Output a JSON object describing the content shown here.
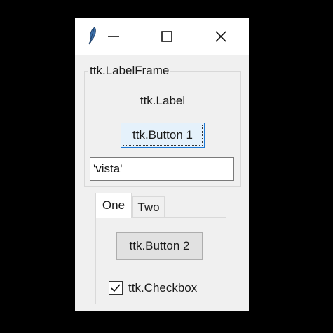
{
  "titlebar": {
    "app_icon": "feather-icon",
    "minimize_icon": "minimize-icon",
    "maximize_icon": "maximize-icon",
    "close_icon": "close-icon"
  },
  "labelframe": {
    "title": "ttk.LabelFrame",
    "label": "ttk.Label",
    "button_label": "ttk.Button 1",
    "entry_value": "'vista'"
  },
  "notebook": {
    "tabs": [
      {
        "label": "One",
        "selected": true
      },
      {
        "label": "Two",
        "selected": false
      }
    ],
    "button_label": "ttk.Button 2",
    "checkbox_label": "ttk.Checkbox",
    "checkbox_checked": true
  },
  "colors": {
    "window_bg": "#f0f0f0",
    "titlebar_bg": "#ffffff",
    "focus_border": "#1e78d4",
    "backdrop": "#000000"
  }
}
